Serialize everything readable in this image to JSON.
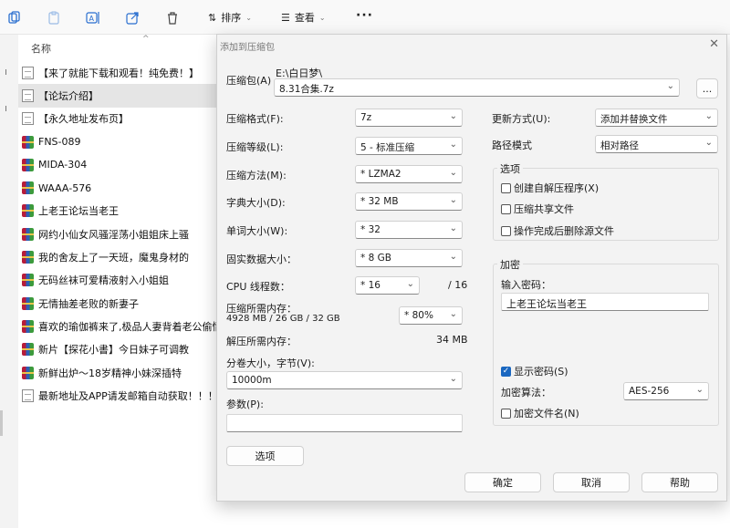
{
  "colors": {
    "accent": "#1a67c0",
    "selected_row": "#e5e5e5",
    "dialog_bg": "#f3f3f3"
  },
  "toolbar": {
    "icons": [
      "copy-icon",
      "paste-icon",
      "rename-icon",
      "share-icon",
      "delete-icon"
    ],
    "sort_label": "排序",
    "view_label": "查看",
    "more_label": "···"
  },
  "explorer": {
    "column_name": "名称",
    "files": [
      {
        "name": "【来了就能下载和观看！纯免费！】",
        "icon": "doc"
      },
      {
        "name": "【论坛介绍】",
        "icon": "doc",
        "selected": true
      },
      {
        "name": "【永久地址发布页】",
        "icon": "doc"
      },
      {
        "name": "FNS-089",
        "icon": "rar"
      },
      {
        "name": "MIDA-304",
        "icon": "rar"
      },
      {
        "name": "WAAA-576",
        "icon": "rar"
      },
      {
        "name": "上老王论坛当老王",
        "icon": "rar"
      },
      {
        "name": "网约小仙女风骚淫荡小姐姐床上骚",
        "icon": "rar"
      },
      {
        "name": "我的舍友上了一天班，魔鬼身材的",
        "icon": "rar"
      },
      {
        "name": "无码丝袜可爱精液射入小姐姐",
        "icon": "rar"
      },
      {
        "name": "无情抽差老败的新妻子",
        "icon": "rar"
      },
      {
        "name": "喜欢的瑜伽裤来了,极品人妻背着老公偷情",
        "icon": "rar"
      },
      {
        "name": "新片【探花小書】今日妹子可调教",
        "icon": "rar"
      },
      {
        "name": "新鲜出炉～18岁精神小妹深插特",
        "icon": "rar"
      },
      {
        "name": "最新地址及APP请发邮箱自动获取！！！",
        "icon": "doc"
      }
    ]
  },
  "dialog": {
    "title": "添加到压缩包",
    "archive_label": "压缩包(A)",
    "archive_path": "E:\\白日梦\\",
    "archive_name": "8.31合集.7z",
    "browse_label": "...",
    "format_label": "压缩格式(F):",
    "format_value": "7z",
    "level_label": "压缩等级(L):",
    "level_value": "5 - 标准压缩",
    "method_label": "压缩方法(M):",
    "method_value": "* LZMA2",
    "dict_label": "字典大小(D):",
    "dict_value": "* 32 MB",
    "word_label": "单词大小(W):",
    "word_value": "* 32",
    "solid_label": "固实数据大小：",
    "solid_value": "* 8 GB",
    "cpu_label": "CPU 线程数：",
    "cpu_value": "* 16",
    "cpu_max": "/ 16",
    "mem_comp_label": "压缩所需内存：",
    "mem_comp_value": "4928 MB / 26 GB / 32 GB",
    "mem_percent": "* 80%",
    "mem_decomp_label": "解压所需内存：",
    "mem_decomp_value": "34 MB",
    "split_label": "分卷大小，字节(V):",
    "split_value": "10000m",
    "params_label": "参数(P):",
    "params_value": "",
    "options_button": "选项",
    "update_label": "更新方式(U):",
    "update_value": "添加并替换文件",
    "path_label": "路径模式",
    "path_value": "相对路径",
    "options_group": "选项",
    "opt_sfx": "创建自解压程序(X)",
    "opt_shared": "压缩共享文件",
    "opt_delete": "操作完成后删除源文件",
    "encryption_group": "加密",
    "password_label": "输入密码：",
    "password_value": "上老王论坛当老王",
    "show_password": "显示密码(S)",
    "enc_method_label": "加密算法：",
    "enc_method_value": "AES-256",
    "enc_names": "加密文件名(N)",
    "ok": "确定",
    "cancel": "取消",
    "help": "帮助"
  }
}
